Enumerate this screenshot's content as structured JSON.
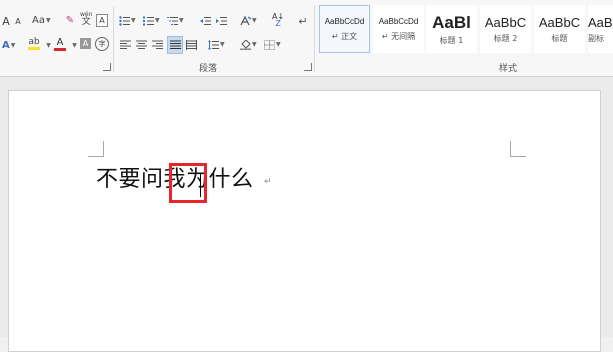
{
  "ribbon": {
    "font_group": {
      "grow_font": "A",
      "shrink_font": "A",
      "change_case": "Aa",
      "clear_format": "✗",
      "phonetic_guide": "wén",
      "char_border": "A",
      "text_effect": "A",
      "highlight": "ab",
      "font_color": "A",
      "char_shading": "A",
      "enclose_char": "字"
    },
    "paragraph_group": {
      "label": "段落",
      "sort": "A↓Z",
      "show_marks": "↵"
    },
    "styles_group": {
      "label": "样式",
      "items": [
        {
          "sample": "AaBbCcDd",
          "name": "↵ 正文"
        },
        {
          "sample": "AaBbCcDd",
          "name": "↵ 无间隔"
        },
        {
          "sample": "AaBl",
          "name": "标题 1"
        },
        {
          "sample": "AaBbC",
          "name": "标题 2"
        },
        {
          "sample": "AaBbC",
          "name": "标题"
        },
        {
          "sample": "AaB",
          "name": "副标"
        }
      ]
    }
  },
  "document": {
    "text": "不要问我为什么",
    "paragraph_mark": "↵"
  },
  "colors": {
    "highlight_box": "#e8252b",
    "font_color_bar": "#d9262b",
    "highlight_color_bar": "#f5e22b",
    "accent_blue": "#2b579a"
  }
}
